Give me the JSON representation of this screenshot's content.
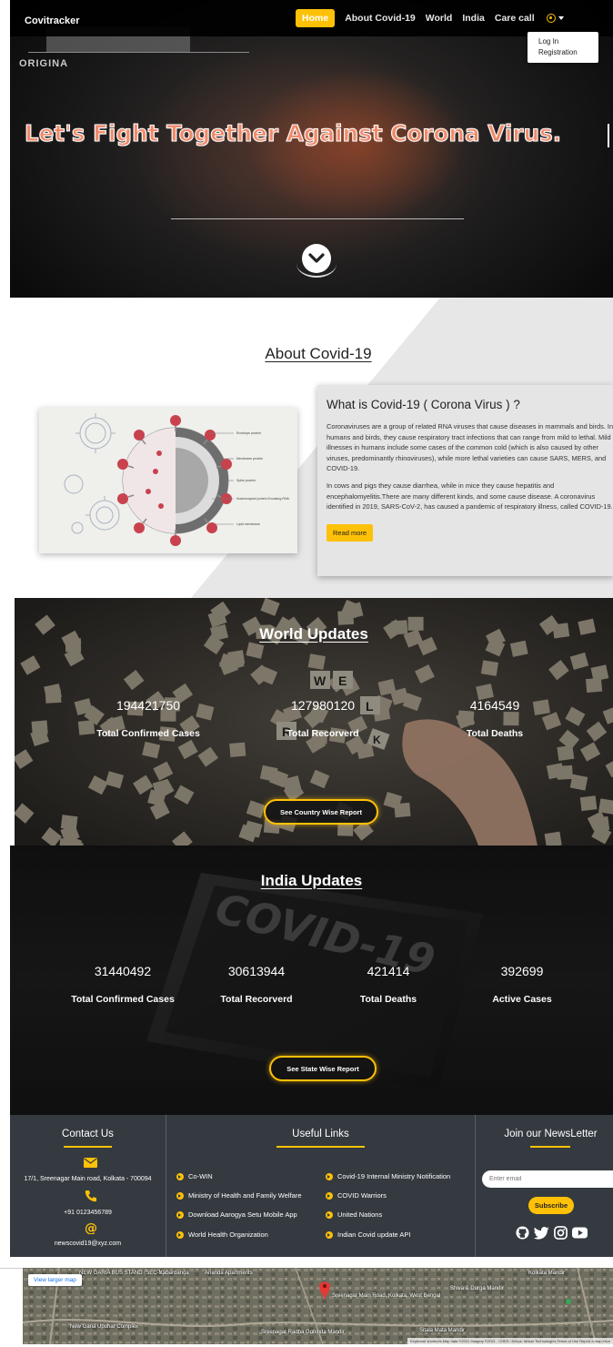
{
  "navbar": {
    "brand": "Covitracker",
    "links": [
      "Home",
      "About Covid-19",
      "World",
      "India",
      "Care call"
    ],
    "active_link": "Home",
    "user_menu": [
      "Log In",
      "Registration"
    ]
  },
  "hero": {
    "origin_label": "ORIGINA",
    "title": "Let's Fight Together Against Corona Virus."
  },
  "about": {
    "title": "About Covid-19",
    "heading": "What is Covid-19 ( Corona Virus ) ?",
    "para1": "Coronaviruses are a group of related RNA viruses that cause diseases in mammals and birds. In humans and birds, they cause respiratory tract infections that can range from mild to lethal. Mild illnesses in humans include some cases of the common cold (which is also caused by other viruses, predominantly rhinoviruses), while more lethal varieties can cause SARS, MERS, and COVID-19.",
    "para2": "In cows and pigs they cause diarrhea, while in mice they cause hepatitis and encephalomyelitis.There are many different kinds, and some cause disease. A coronavirus identified in 2019, SARS-CoV-2, has caused a pandemic of respiratory illness, called COVID-19.",
    "read_more": "Read more",
    "diagram_labels": [
      "Envelope protein",
      "Membrane protein",
      "Spike protein",
      "Nucleocapsid protein Encasing RNA",
      "Lipid membrane"
    ]
  },
  "world": {
    "title": "World Updates",
    "tile_letters": [
      "W",
      "E",
      "L",
      "R",
      "K"
    ],
    "stats": [
      {
        "value": "194421750",
        "label": "Total Confirmed Cases"
      },
      {
        "value": "127980120",
        "label": "Total Recorverd"
      },
      {
        "value": "4164549",
        "label": "Total Deaths"
      }
    ],
    "button": "See Country Wise Report"
  },
  "india": {
    "title": "India Updates",
    "bg_text": "COVID-19",
    "stats": [
      {
        "value": "31440492",
        "label": "Total Confirmed Cases"
      },
      {
        "value": "30613944",
        "label": "Total Recorverd"
      },
      {
        "value": "421414",
        "label": "Total Deaths"
      },
      {
        "value": "392699",
        "label": "Active Cases"
      }
    ],
    "button": "See State Wise Report"
  },
  "footer": {
    "contact": {
      "title": "Contact Us",
      "address": "17/1, Sreenagar Main road, Kolkata - 700094",
      "phone": "+91 0123456789",
      "email": "newscovid19@xyz.com"
    },
    "links": {
      "title": "Useful Links",
      "left": [
        "Co-WIN",
        "Ministry of Health and Family Welfare",
        "Download Aarogya Setu Mobile App",
        "World Health Organization"
      ],
      "right": [
        "Covid-19 Internal Ministry Notification",
        "COVID Warriors",
        "United Nations",
        "Indian Covid update API"
      ]
    },
    "newsletter": {
      "title": "Join our NewsLetter",
      "placeholder": "Enter email",
      "subscribe": "Subscribe"
    }
  },
  "map": {
    "button": "View larger map",
    "labels": [
      "NEW GARIA BUS STAND (SEC-V)",
      "Kabardanga",
      "Ananda Apartments",
      "Sreenagar Main Road, Kolkata, West Bengal",
      "Kolkata Mandir",
      "Shiva & Durga Mandir",
      "New Garia Upohar Complex",
      "Sreenagar Radha Gobinda Mandir",
      "Sitala Mata Mandir"
    ],
    "attribution": "Keyboard shortcuts  Map data ©2021 Imagery ©2021 , CNES / Airbus, Maxar Technologies  Terms of Use  Report a map error"
  },
  "colors": {
    "accent": "#ffc107",
    "footer_bg": "#343a40",
    "hero_title": "#f08a6a"
  }
}
